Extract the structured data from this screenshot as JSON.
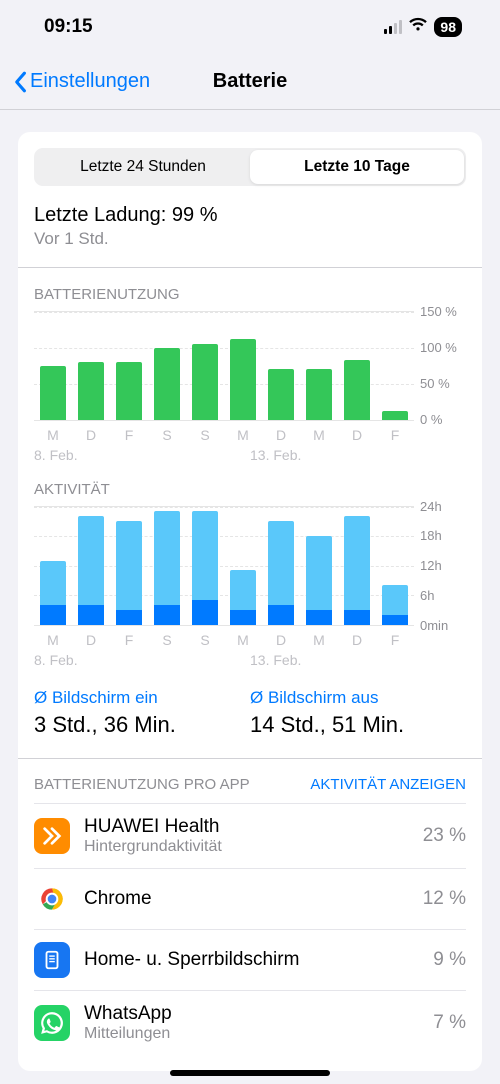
{
  "status": {
    "time": "09:15",
    "battery_pct": "98"
  },
  "nav": {
    "back_label": "Einstellungen",
    "title": "Batterie"
  },
  "tabs": {
    "t24h": "Letzte 24 Stunden",
    "t10d": "Letzte 10 Tage"
  },
  "last_charge": {
    "title": "Letzte Ladung: 99 %",
    "time": "Vor 1 Std."
  },
  "battery_section_label": "BATTERIENUTZUNG",
  "activity_section_label": "AKTIVITÄT",
  "averages": {
    "on_label": "Ø Bildschirm ein",
    "on_value": "3 Std., 36 Min.",
    "off_label": "Ø Bildschirm aus",
    "off_value": "14 Std., 51 Min."
  },
  "perapp": {
    "title": "BATTERIENUTZUNG PRO APP",
    "action": "AKTIVITÄT ANZEIGEN",
    "rows": [
      {
        "name": "HUAWEI Health",
        "sub": "Hintergrundaktivität",
        "pct": "23 %"
      },
      {
        "name": "Chrome",
        "sub": "",
        "pct": "12 %"
      },
      {
        "name": "Home- u. Sperrbildschirm",
        "sub": "",
        "pct": "9 %"
      },
      {
        "name": "WhatsApp",
        "sub": "Mitteilungen",
        "pct": "7 %"
      }
    ]
  },
  "chart_data": [
    {
      "type": "bar",
      "title": "BATTERIENUTZUNG",
      "ylabel": "%",
      "ylim": [
        0,
        150
      ],
      "yticks": [
        "150 %",
        "100 %",
        "50 %",
        "0 %"
      ],
      "categories": [
        "M",
        "D",
        "F",
        "S",
        "S",
        "M",
        "D",
        "M",
        "D",
        "F"
      ],
      "date_marks": [
        "8. Feb.",
        "13. Feb."
      ],
      "values": [
        75,
        80,
        80,
        100,
        105,
        112,
        70,
        70,
        82,
        12
      ]
    },
    {
      "type": "bar",
      "title": "AKTIVITÄT",
      "ylabel": "h",
      "ylim": [
        0,
        24
      ],
      "yticks": [
        "24h",
        "18h",
        "12h",
        "6h",
        "0min"
      ],
      "categories": [
        "M",
        "D",
        "F",
        "S",
        "S",
        "M",
        "D",
        "M",
        "D",
        "F"
      ],
      "date_marks": [
        "8. Feb.",
        "13. Feb."
      ],
      "series": [
        {
          "name": "Bildschirm aus",
          "color": "#5ac8fa",
          "values": [
            9,
            18,
            18,
            19,
            18,
            8,
            17,
            15,
            19,
            6
          ]
        },
        {
          "name": "Bildschirm ein",
          "color": "#007aff",
          "values": [
            4,
            4,
            3,
            4,
            5,
            3,
            4,
            3,
            3,
            2
          ]
        }
      ]
    }
  ]
}
